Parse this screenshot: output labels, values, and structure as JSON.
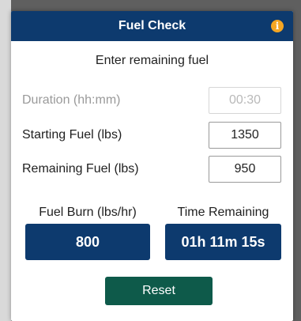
{
  "dialog": {
    "title": "Fuel Check",
    "info_icon": "info-icon",
    "info_glyph": "i",
    "subtitle": "Enter remaining fuel"
  },
  "fields": {
    "duration": {
      "label": "Duration (hh:mm)",
      "value": "00:30",
      "disabled": true
    },
    "starting_fuel": {
      "label": "Starting Fuel (lbs)",
      "value": "1350"
    },
    "remaining_fuel": {
      "label": "Remaining Fuel (lbs)",
      "value": "950"
    }
  },
  "results": {
    "fuel_burn": {
      "label": "Fuel Burn (lbs/hr)",
      "value": "800"
    },
    "time_remaining": {
      "label": "Time Remaining",
      "value": "01h 11m 15s"
    }
  },
  "buttons": {
    "reset": "Reset"
  },
  "colors": {
    "header": "#0d3a6e",
    "result_box": "#0d3a6e",
    "reset_button": "#0e5a4a",
    "info_icon": "#f5a623"
  }
}
